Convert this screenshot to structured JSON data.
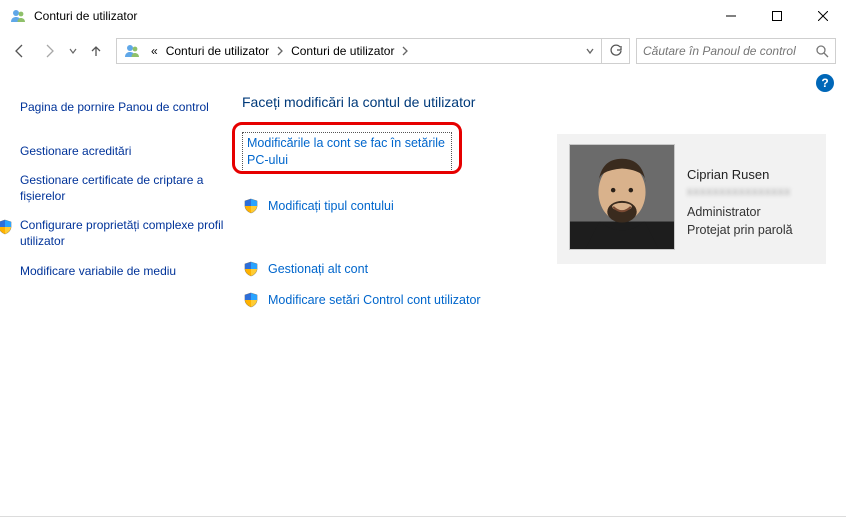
{
  "window": {
    "title": "Conturi de utilizator"
  },
  "breadcrumb": {
    "prefix": "«",
    "item1": "Conturi de utilizator",
    "item2": "Conturi de utilizator"
  },
  "search": {
    "placeholder": "Căutare în Panoul de control"
  },
  "sidebar": {
    "home": "Pagina de pornire Panou de control",
    "items": [
      {
        "label": "Gestionare acreditări"
      },
      {
        "label": "Gestionare certificate de criptare a fișierelor"
      },
      {
        "label": "Configurare proprietăți complexe profil utilizator",
        "shield": true
      },
      {
        "label": "Modificare variabile de mediu"
      }
    ]
  },
  "main": {
    "title": "Faceți modificări la contul de utilizator",
    "links": {
      "change_in_settings": "Modificările la cont se fac în setările PC-ului",
      "change_type": "Modificați tipul contului",
      "manage_another": "Gestionați alt cont",
      "uac": "Modificare setări Control cont utilizator"
    }
  },
  "account": {
    "name": "Ciprian Rusen",
    "email_blurred": "xxxxxxxxxxxxxxxx",
    "role": "Administrator",
    "protection": "Protejat prin parolă"
  },
  "help_glyph": "?"
}
